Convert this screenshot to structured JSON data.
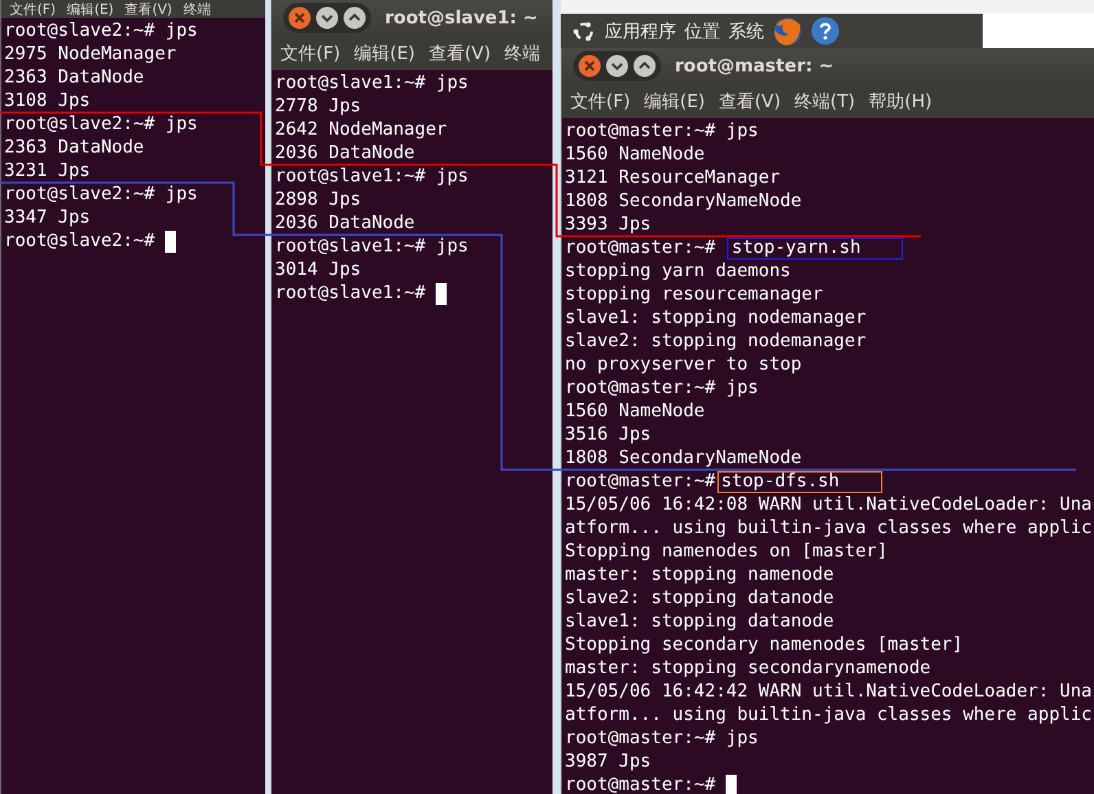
{
  "panel": {
    "items": [
      "应用程序",
      "位置",
      "系统"
    ]
  },
  "windows": [
    {
      "menu": [
        "文件(F)",
        "编辑(E)",
        "查看(V)",
        "终端"
      ],
      "cursor": true,
      "lines": [
        "root@slave2:~# jps",
        "2975 NodeManager",
        "2363 DataNode",
        "3108 Jps",
        "root@slave2:~# jps",
        "2363 DataNode",
        "3231 Jps",
        "root@slave2:~# jps",
        "3347 Jps",
        "root@slave2:~# "
      ]
    },
    {
      "title": "root@slave1: ~",
      "menu": [
        "文件(F)",
        "编辑(E)",
        "查看(V)",
        "终端"
      ],
      "cursor": true,
      "lines": [
        "root@slave1:~# jps",
        "2778 Jps",
        "2642 NodeManager",
        "2036 DataNode",
        "root@slave1:~# jps",
        "2898 Jps",
        "2036 DataNode",
        "root@slave1:~# jps",
        "3014 Jps",
        "root@slave1:~# "
      ]
    },
    {
      "title": "root@master: ~",
      "menu": [
        "文件(F)",
        "编辑(E)",
        "查看(V)",
        "终端(T)",
        "帮助(H)"
      ],
      "cursor": true,
      "lines": [
        "root@master:~# jps",
        "1560 NameNode",
        "3121 ResourceManager",
        "1808 SecondaryNameNode",
        "3393 Jps",
        {
          "prompt": "root@master:~# ",
          "command": "stop-yarn.sh",
          "color": "#2020e0"
        },
        "stopping yarn daemons",
        "stopping resourcemanager",
        "slave1: stopping nodemanager",
        "slave2: stopping nodemanager",
        "no proxyserver to stop",
        "root@master:~# jps",
        "1560 NameNode",
        "3516 Jps",
        "1808 SecondaryNameNode",
        {
          "prompt": "root@master:~#",
          "command": "stop-dfs.sh",
          "color": "#f08030"
        },
        "15/05/06 16:42:08 WARN util.NativeCodeLoader: Una",
        "atform... using builtin-java classes where applic",
        "Stopping namenodes on [master]",
        "master: stopping namenode",
        "slave2: stopping datanode",
        "slave1: stopping datanode",
        "Stopping secondary namenodes [master]",
        "master: stopping secondarynamenode",
        "15/05/06 16:42:42 WARN util.NativeCodeLoader: Una",
        "atform... using builtin-java classes where applic",
        "root@master:~# jps",
        "3987 Jps",
        "root@master:~# "
      ]
    }
  ]
}
